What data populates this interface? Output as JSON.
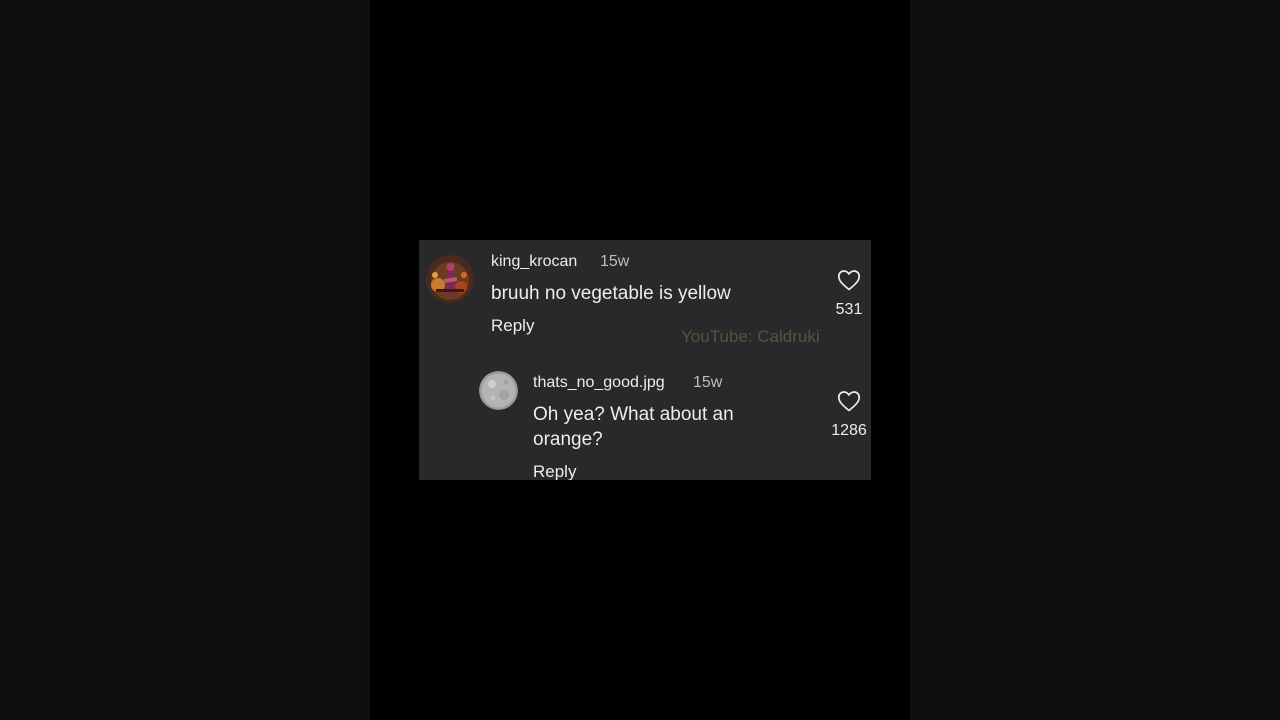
{
  "comments": [
    {
      "username": "king_krocan",
      "time_ago": "15w",
      "text": "bruuh no vegetable is yellow",
      "reply_label": "Reply",
      "like_count": "531",
      "avatar": "king-krocan-avatar"
    },
    {
      "username": "thats_no_good.jpg",
      "time_ago": "15w",
      "text": "Oh yea? What about an orange?",
      "reply_label": "Reply",
      "like_count": "1286",
      "avatar": "grey-moon-avatar"
    }
  ],
  "watermark": "YouTube: Caldruki",
  "icons": {
    "like": "heart-outline-icon"
  },
  "colors": {
    "card_background": "#29292c",
    "text_primary": "#ececec",
    "text_secondary": "#bdbdbd",
    "watermark": "#5e5a3c"
  }
}
